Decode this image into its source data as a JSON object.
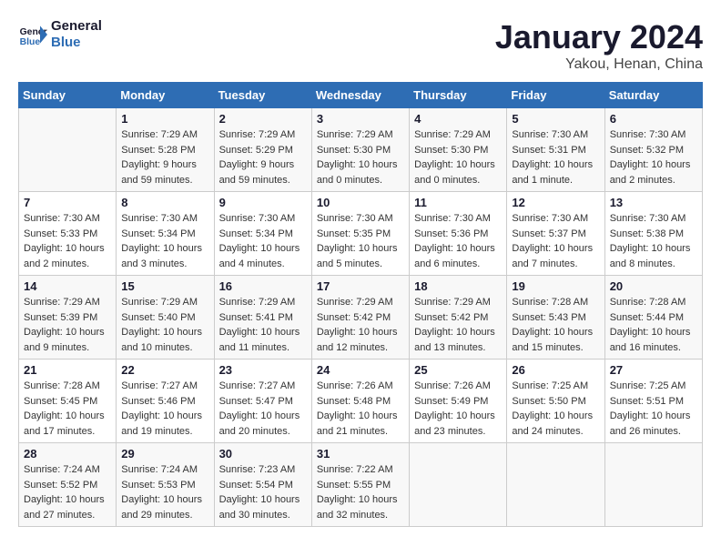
{
  "logo": {
    "text_general": "General",
    "text_blue": "Blue"
  },
  "title": "January 2024",
  "subtitle": "Yakou, Henan, China",
  "days_of_week": [
    "Sunday",
    "Monday",
    "Tuesday",
    "Wednesday",
    "Thursday",
    "Friday",
    "Saturday"
  ],
  "weeks": [
    [
      {
        "day": "",
        "info": ""
      },
      {
        "day": "1",
        "info": "Sunrise: 7:29 AM\nSunset: 5:28 PM\nDaylight: 9 hours\nand 59 minutes."
      },
      {
        "day": "2",
        "info": "Sunrise: 7:29 AM\nSunset: 5:29 PM\nDaylight: 9 hours\nand 59 minutes."
      },
      {
        "day": "3",
        "info": "Sunrise: 7:29 AM\nSunset: 5:30 PM\nDaylight: 10 hours\nand 0 minutes."
      },
      {
        "day": "4",
        "info": "Sunrise: 7:29 AM\nSunset: 5:30 PM\nDaylight: 10 hours\nand 0 minutes."
      },
      {
        "day": "5",
        "info": "Sunrise: 7:30 AM\nSunset: 5:31 PM\nDaylight: 10 hours\nand 1 minute."
      },
      {
        "day": "6",
        "info": "Sunrise: 7:30 AM\nSunset: 5:32 PM\nDaylight: 10 hours\nand 2 minutes."
      }
    ],
    [
      {
        "day": "7",
        "info": "Sunrise: 7:30 AM\nSunset: 5:33 PM\nDaylight: 10 hours\nand 2 minutes."
      },
      {
        "day": "8",
        "info": "Sunrise: 7:30 AM\nSunset: 5:34 PM\nDaylight: 10 hours\nand 3 minutes."
      },
      {
        "day": "9",
        "info": "Sunrise: 7:30 AM\nSunset: 5:34 PM\nDaylight: 10 hours\nand 4 minutes."
      },
      {
        "day": "10",
        "info": "Sunrise: 7:30 AM\nSunset: 5:35 PM\nDaylight: 10 hours\nand 5 minutes."
      },
      {
        "day": "11",
        "info": "Sunrise: 7:30 AM\nSunset: 5:36 PM\nDaylight: 10 hours\nand 6 minutes."
      },
      {
        "day": "12",
        "info": "Sunrise: 7:30 AM\nSunset: 5:37 PM\nDaylight: 10 hours\nand 7 minutes."
      },
      {
        "day": "13",
        "info": "Sunrise: 7:30 AM\nSunset: 5:38 PM\nDaylight: 10 hours\nand 8 minutes."
      }
    ],
    [
      {
        "day": "14",
        "info": "Sunrise: 7:29 AM\nSunset: 5:39 PM\nDaylight: 10 hours\nand 9 minutes."
      },
      {
        "day": "15",
        "info": "Sunrise: 7:29 AM\nSunset: 5:40 PM\nDaylight: 10 hours\nand 10 minutes."
      },
      {
        "day": "16",
        "info": "Sunrise: 7:29 AM\nSunset: 5:41 PM\nDaylight: 10 hours\nand 11 minutes."
      },
      {
        "day": "17",
        "info": "Sunrise: 7:29 AM\nSunset: 5:42 PM\nDaylight: 10 hours\nand 12 minutes."
      },
      {
        "day": "18",
        "info": "Sunrise: 7:29 AM\nSunset: 5:42 PM\nDaylight: 10 hours\nand 13 minutes."
      },
      {
        "day": "19",
        "info": "Sunrise: 7:28 AM\nSunset: 5:43 PM\nDaylight: 10 hours\nand 15 minutes."
      },
      {
        "day": "20",
        "info": "Sunrise: 7:28 AM\nSunset: 5:44 PM\nDaylight: 10 hours\nand 16 minutes."
      }
    ],
    [
      {
        "day": "21",
        "info": "Sunrise: 7:28 AM\nSunset: 5:45 PM\nDaylight: 10 hours\nand 17 minutes."
      },
      {
        "day": "22",
        "info": "Sunrise: 7:27 AM\nSunset: 5:46 PM\nDaylight: 10 hours\nand 19 minutes."
      },
      {
        "day": "23",
        "info": "Sunrise: 7:27 AM\nSunset: 5:47 PM\nDaylight: 10 hours\nand 20 minutes."
      },
      {
        "day": "24",
        "info": "Sunrise: 7:26 AM\nSunset: 5:48 PM\nDaylight: 10 hours\nand 21 minutes."
      },
      {
        "day": "25",
        "info": "Sunrise: 7:26 AM\nSunset: 5:49 PM\nDaylight: 10 hours\nand 23 minutes."
      },
      {
        "day": "26",
        "info": "Sunrise: 7:25 AM\nSunset: 5:50 PM\nDaylight: 10 hours\nand 24 minutes."
      },
      {
        "day": "27",
        "info": "Sunrise: 7:25 AM\nSunset: 5:51 PM\nDaylight: 10 hours\nand 26 minutes."
      }
    ],
    [
      {
        "day": "28",
        "info": "Sunrise: 7:24 AM\nSunset: 5:52 PM\nDaylight: 10 hours\nand 27 minutes."
      },
      {
        "day": "29",
        "info": "Sunrise: 7:24 AM\nSunset: 5:53 PM\nDaylight: 10 hours\nand 29 minutes."
      },
      {
        "day": "30",
        "info": "Sunrise: 7:23 AM\nSunset: 5:54 PM\nDaylight: 10 hours\nand 30 minutes."
      },
      {
        "day": "31",
        "info": "Sunrise: 7:22 AM\nSunset: 5:55 PM\nDaylight: 10 hours\nand 32 minutes."
      },
      {
        "day": "",
        "info": ""
      },
      {
        "day": "",
        "info": ""
      },
      {
        "day": "",
        "info": ""
      }
    ]
  ]
}
